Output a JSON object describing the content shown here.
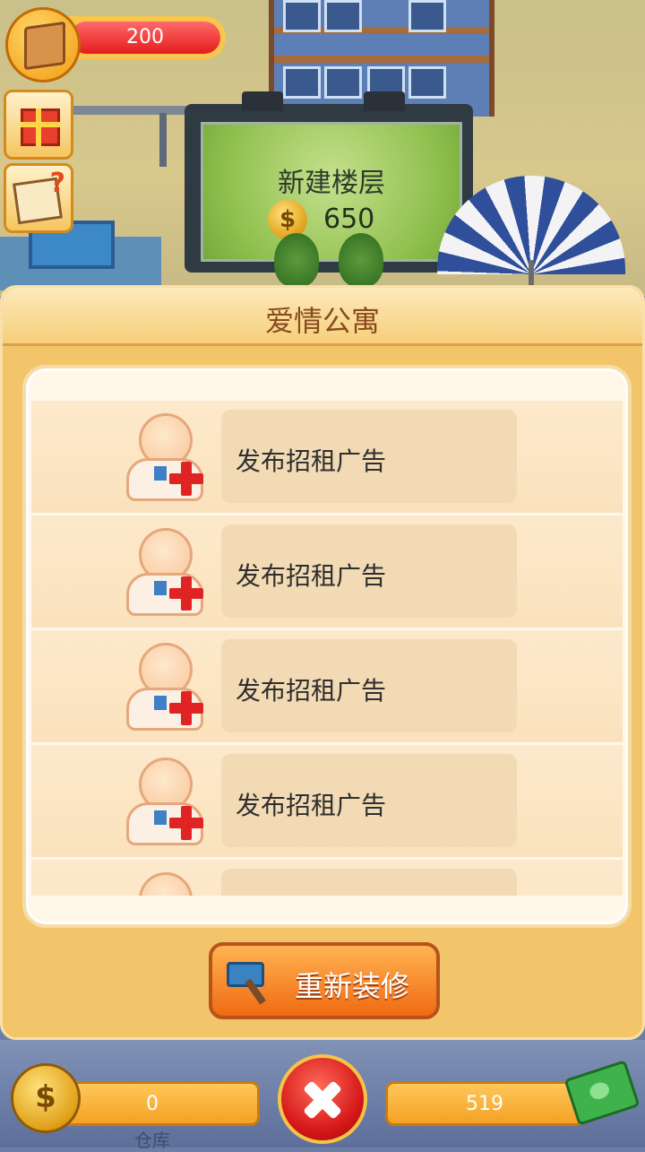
{
  "hud": {
    "box_value": "200",
    "box_icon": "package-box-icon",
    "gift_icon": "gift-icon",
    "quest_icon": "help-note-icon"
  },
  "billboard": {
    "title": "新建楼层",
    "coin_symbol": "$",
    "price": "650"
  },
  "dialog": {
    "title": "爱情公寓",
    "rows": [
      {
        "label": "发布招租广告"
      },
      {
        "label": "发布招租广告"
      },
      {
        "label": "发布招租广告"
      },
      {
        "label": "发布招租广告"
      },
      {
        "label": ""
      }
    ],
    "renovate_label": "重新装修"
  },
  "bottom_bar": {
    "coin_symbol": "$",
    "coins": "0",
    "cash": "519",
    "faint_label": "仓库"
  },
  "colors": {
    "panel": "#f3c56b",
    "title_text": "#8a4a1d",
    "hud_red": "#e41c1c",
    "button_orange": "#f06a12"
  }
}
